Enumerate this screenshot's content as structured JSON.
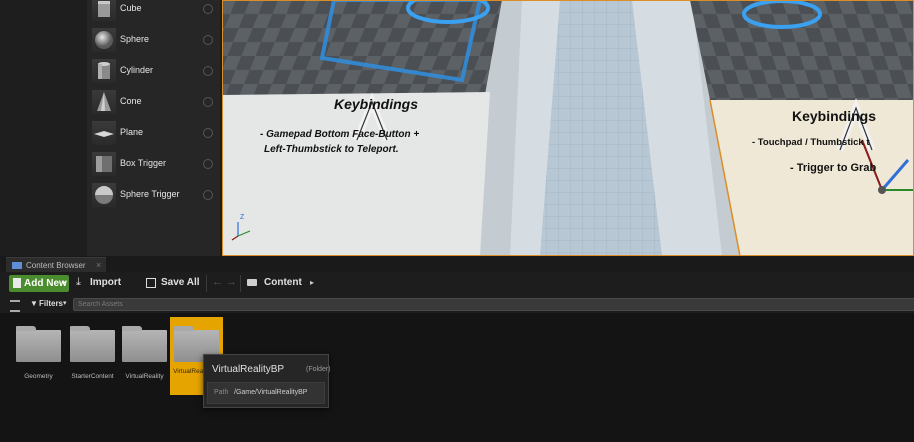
{
  "place_actors": {
    "items": [
      {
        "label": "Cube",
        "icon": "cube-icon"
      },
      {
        "label": "Sphere",
        "icon": "sphere-icon"
      },
      {
        "label": "Cylinder",
        "icon": "cylinder-icon"
      },
      {
        "label": "Cone",
        "icon": "cone-icon"
      },
      {
        "label": "Plane",
        "icon": "plane-icon"
      },
      {
        "label": "Box Trigger",
        "icon": "box-trigger-icon"
      },
      {
        "label": "Sphere Trigger",
        "icon": "sphere-trigger-icon"
      }
    ]
  },
  "viewport": {
    "sign_left_title": "Keybindings",
    "sign_left_line1": "- Gamepad Bottom Face-Button +",
    "sign_left_line2": "Left-Thumbstick to Teleport.",
    "sign_right_title": "Keybindings",
    "sign_right_line1": "- Touchpad / Thumbstick t",
    "sign_right_line2": "- Trigger to Grab",
    "axis_label": "Z"
  },
  "content_browser": {
    "tab_label": "Content Browser",
    "toolbar": {
      "add_new": "Add New",
      "import": "Import",
      "save_all": "Save All",
      "breadcrumb": "Content"
    },
    "filters_label": "Filters",
    "search_placeholder": "Search Assets",
    "folders": [
      {
        "label": "Geometry"
      },
      {
        "label": "StarterContent"
      },
      {
        "label": "VirtualReality"
      },
      {
        "label": "VirtualRealityBP",
        "selected": true
      }
    ],
    "tooltip": {
      "name": "VirtualRealityBP",
      "kind": "(Folder)",
      "path_label": "Path",
      "path": "/Game/VirtualRealityBP"
    }
  },
  "colors": {
    "add_new": "#4a8c2e",
    "selection": "#e6a400",
    "viewport_outline": "#d98e2a",
    "hologram": "#2f8fe0"
  }
}
